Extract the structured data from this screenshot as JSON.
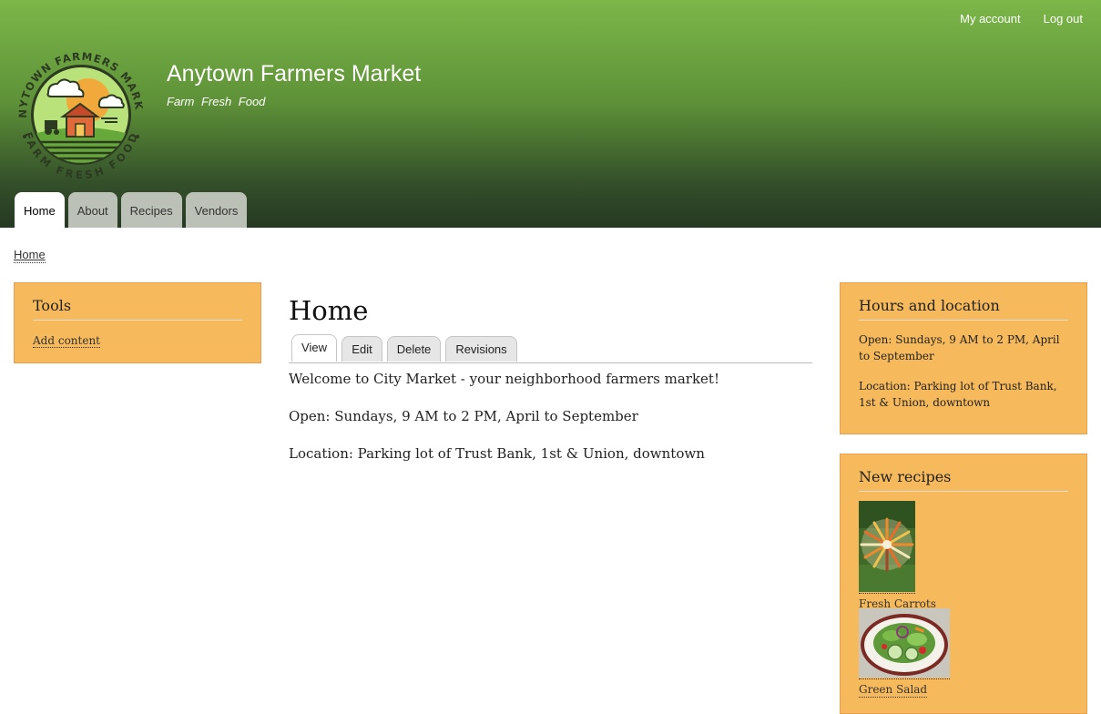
{
  "header": {
    "site_name": "Anytown Farmers Market",
    "site_slogan": "Farm Fresh Food",
    "logo_text_top": "ANYTOWN FARMERS MARKET",
    "logo_text_bottom": "FARM FRESH FOOD",
    "secondary_menu": [
      "My account",
      "Log out"
    ],
    "main_menu": [
      {
        "label": "Home",
        "active": true
      },
      {
        "label": "About",
        "active": false
      },
      {
        "label": "Recipes",
        "active": false
      },
      {
        "label": "Vendors",
        "active": false
      }
    ]
  },
  "breadcrumb": "Home",
  "sidebar_first": {
    "tools": {
      "title": "Tools",
      "link": "Add content"
    }
  },
  "content": {
    "title": "Home",
    "tabs": [
      {
        "label": "View",
        "active": true
      },
      {
        "label": "Edit",
        "active": false
      },
      {
        "label": "Delete",
        "active": false
      },
      {
        "label": "Revisions",
        "active": false
      }
    ],
    "paragraphs": [
      "Welcome to City Market - your neighborhood farmers market!",
      "Open: Sundays, 9 AM to 2 PM, April to September",
      "Location: Parking lot of Trust Bank, 1st & Union, downtown"
    ]
  },
  "sidebar_second": {
    "hours": {
      "title": "Hours and location",
      "open": "Open: Sundays, 9 AM to 2 PM, April to September",
      "location": "Location: Parking lot of Trust Bank, 1st & Union, downtown"
    },
    "recipes": {
      "title": "New recipes",
      "items": [
        {
          "label": "Fresh Carrots",
          "icon": "carrots-photo"
        },
        {
          "label": "Green Salad",
          "icon": "salad-photo"
        }
      ]
    }
  },
  "colors": {
    "header_top": "#7cb749",
    "header_bottom": "#263823",
    "block_bg": "#f6b95c",
    "tab_inactive": "#bcc1b7"
  }
}
